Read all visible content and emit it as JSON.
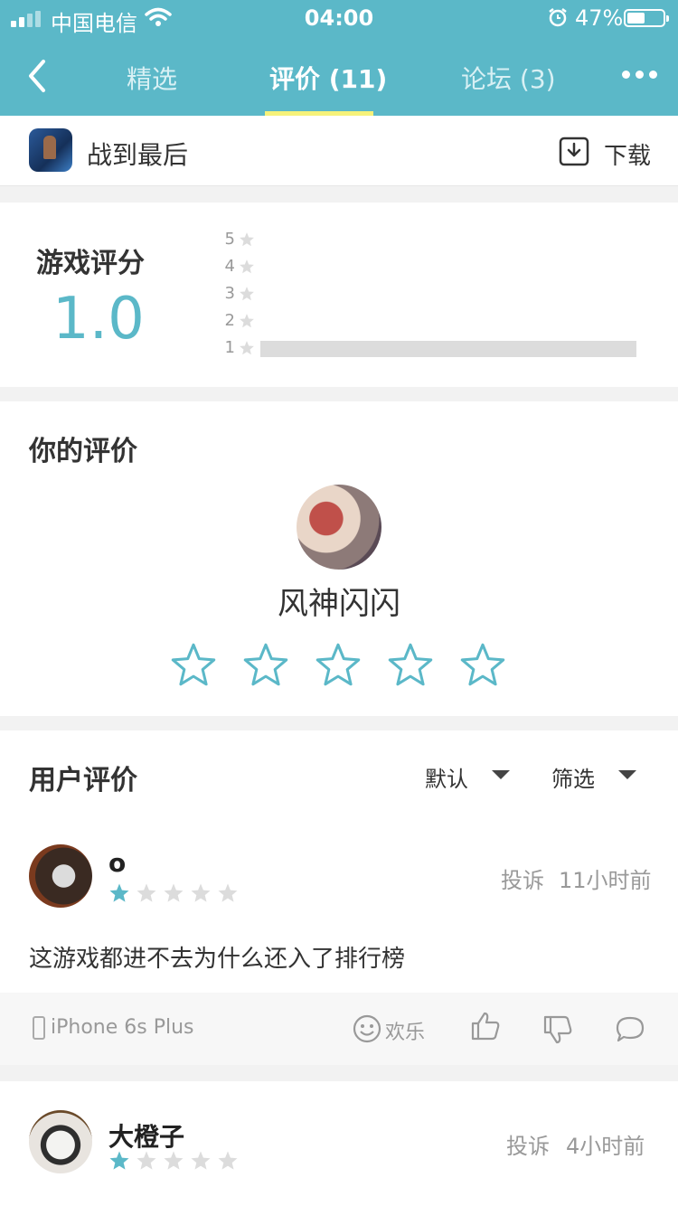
{
  "status_bar": {
    "carrier": "中国电信",
    "time": "04:00",
    "battery": "47%"
  },
  "nav": {
    "tabs": [
      {
        "label": "精选"
      },
      {
        "label": "评价 (11)"
      },
      {
        "label": "论坛 (3)"
      }
    ]
  },
  "app": {
    "name": "战到最后",
    "download_label": "下载"
  },
  "rating": {
    "label": "游戏评分",
    "score": "1.0",
    "histogram": [
      {
        "stars": "5",
        "fraction": 0
      },
      {
        "stars": "4",
        "fraction": 0
      },
      {
        "stars": "3",
        "fraction": 0
      },
      {
        "stars": "2",
        "fraction": 0
      },
      {
        "stars": "1",
        "fraction": 1.0
      }
    ]
  },
  "your_review": {
    "title": "你的评价",
    "username": "风神闪闪",
    "stars_selected": 0
  },
  "user_reviews": {
    "title": "用户评价",
    "sort_label": "默认",
    "filter_label": "筛选",
    "items": [
      {
        "name": "o",
        "rating": 1,
        "report_label": "投诉",
        "time": "11小时前",
        "text": "这游戏都进不去为什么还入了排行榜",
        "device": "iPhone 6s Plus",
        "mood": "欢乐"
      },
      {
        "name": "大橙子",
        "rating": 1,
        "report_label": "投诉",
        "time": "4小时前"
      }
    ]
  },
  "colors": {
    "accent": "#5bb8c8",
    "tab_underline": "#f6f27a",
    "star_empty": "#dcdcdc"
  }
}
